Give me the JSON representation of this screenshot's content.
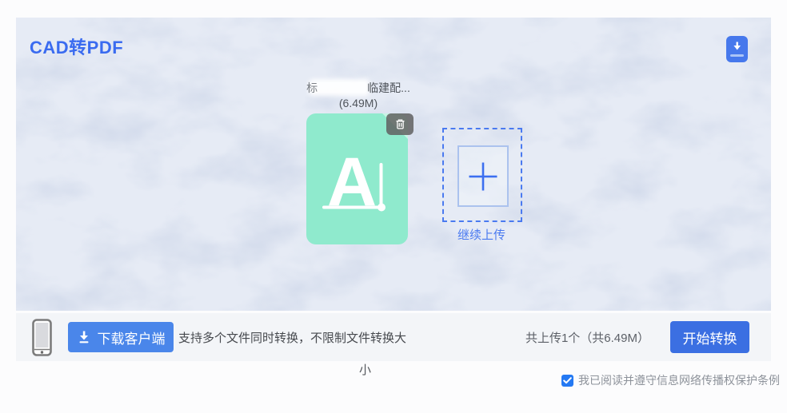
{
  "header": {
    "title": "CAD转PDF"
  },
  "file_card": {
    "name_fragment": "标",
    "name_redacted": true,
    "name_visible": "临建配...",
    "size_label": "(6.49M)"
  },
  "upload": {
    "continue_label": "继续上传"
  },
  "action_bar": {
    "download_client_label": "下载客户端",
    "tip_text": "支持多个文件同时转换，不限制文件转换大",
    "tip_overflow_text": "小",
    "upload_summary": "共上传1个（共6.49M）",
    "convert_label": "开始转换"
  },
  "agreement": {
    "label": "我已阅读并遵守信息网络传播权保护条例",
    "checked": true
  },
  "icons": {
    "top_right_button": "download-icon",
    "file_delete": "trash-icon",
    "bar_left": "phone-icon",
    "download_button": "download-arrow-icon",
    "dropzone": "plus-icon",
    "agreement_box": "checkmark-icon"
  },
  "colors": {
    "title_blue": "#3a6bf0",
    "upload_accent_blue": "#4a7af0",
    "download_button_blue": "#4a86ea",
    "convert_button_blue": "#3b6fe2",
    "floating_badge_blue": "#4678ec",
    "checkbox_blue": "#2479f3",
    "file_icon_mint": "#8feacd",
    "card_background": "#e6ebf5",
    "bar_background": "#f3f5f8"
  }
}
